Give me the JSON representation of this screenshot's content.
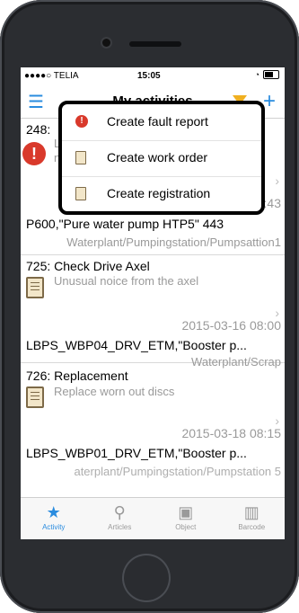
{
  "status": {
    "carrier": "●●●●○ TELIA",
    "time": "15:05"
  },
  "nav": {
    "title": "My activities"
  },
  "items": [
    {
      "id_title": "248:",
      "desc": "L",
      "desc2": "n",
      "date": ":43",
      "object": "P600,\"Pure water pump HTP5\" 443",
      "path": "Waterplant/Pumpingstation/Pumpsattion1"
    },
    {
      "id_title": "725: Check Drive Axel",
      "desc": "Unusual noice from the axel",
      "date": "2015-03-16 08:00",
      "object": "LBPS_WBP04_DRV_ETM,\"Booster p...",
      "path": "Waterplant/Scrap"
    },
    {
      "id_title": "726: Replacement",
      "desc": "Replace worn out discs",
      "date": "2015-03-18 08:15",
      "object": "LBPS_WBP01_DRV_ETM,\"Booster p...",
      "path": "aterplant/Pumpingstation/Pumpstation 5"
    }
  ],
  "popup": {
    "items": [
      {
        "label": "Create fault report"
      },
      {
        "label": "Create work order"
      },
      {
        "label": "Create registration"
      }
    ]
  },
  "tabs": [
    {
      "label": "Activity"
    },
    {
      "label": "Articles"
    },
    {
      "label": "Object"
    },
    {
      "label": "Barcode"
    }
  ]
}
